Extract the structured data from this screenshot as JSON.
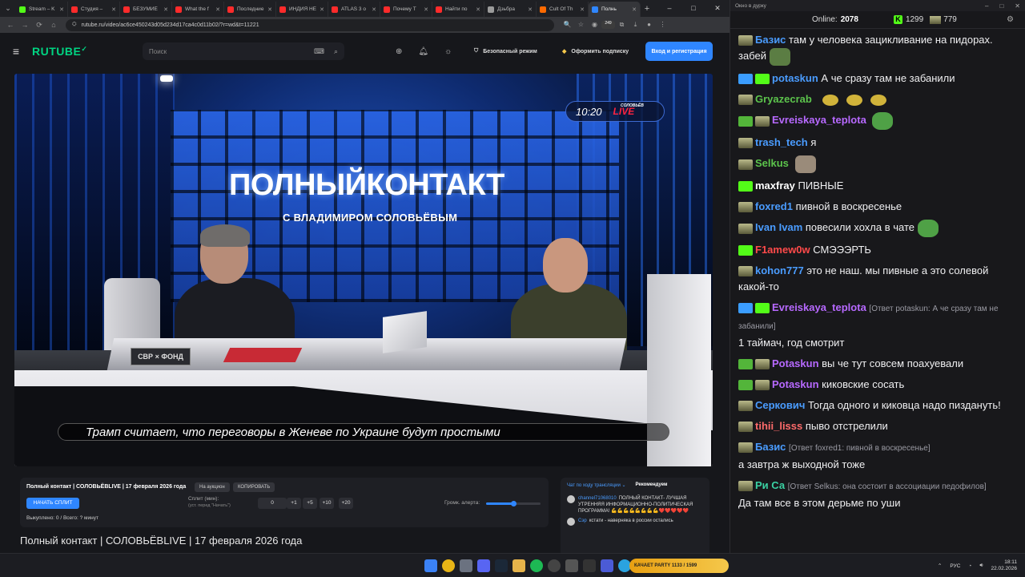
{
  "browser": {
    "tabs": [
      {
        "label": "Stream – K",
        "color": "#53fc18",
        "active": false
      },
      {
        "label": "Студия –",
        "color": "#ff2b2b",
        "active": false
      },
      {
        "label": "БЕЗУМИЕ",
        "color": "#ff2b2b",
        "active": false
      },
      {
        "label": "What the f",
        "color": "#ff2b2b",
        "active": false
      },
      {
        "label": "Последние",
        "color": "#ff2b2b",
        "active": false
      },
      {
        "label": "ИНДИЯ НЕ",
        "color": "#ff2b2b",
        "active": false
      },
      {
        "label": "ATLAS 3 о",
        "color": "#ff2b2b",
        "active": false
      },
      {
        "label": "Почему Т",
        "color": "#ff2b2b",
        "active": false
      },
      {
        "label": "Найти по",
        "color": "#ff2b2b",
        "active": false
      },
      {
        "label": "Дзьбра",
        "color": "#9b9b9b",
        "active": false
      },
      {
        "label": "Cult Of Th",
        "color": "#ff6a00",
        "active": false
      },
      {
        "label": "Полнь",
        "color": "#2f86ff",
        "active": true
      }
    ],
    "url": "rutube.ru/video/ac6ce450243d05d234d17ca4c0d11b02/?r=wd&t=11221",
    "extension_badge": "249"
  },
  "rutube": {
    "logo": "RUTUBE",
    "search_placeholder": "Поиск",
    "safe_mode": "Безопасный режим",
    "subscribe": "Оформить подписку",
    "login": "Вход и регистрация"
  },
  "video": {
    "show_title": "ПОЛНЫЙКОНТАКТ",
    "show_subtitle": "С ВЛАДИМИРОМ СОЛОВЬЁВЫМ",
    "clock": "10:20",
    "live": "LIVE",
    "brand": "СОЛОВЬЁВ",
    "desk_logo": "СВР × ФОНД",
    "caption": "Трамп считает, что переговоры в Женеве по Украине будут простыми"
  },
  "info": {
    "title": "Полный контакт | СОЛОВЬЁВLIVE | 17 февраля 2026 года",
    "chip_auction": "На аукцион",
    "chip_copy": "КОПИРОВАТЬ",
    "start_split": "НАЧАТЬ СПЛИТ",
    "split_label": "Сплит (мин):",
    "split_note": "(уст. перед \"Начать\")",
    "split_value": "0",
    "split_buttons": [
      "+1",
      "+5",
      "+10",
      "+20"
    ],
    "volume_label": "Громк. алерта:",
    "volume_level": 0.5,
    "cut_count": "Выкуплено: 0 / Всего: ? минут",
    "video_title": "Полный контакт | СОЛОВЬЁВLIVE | 17 февраля 2026 года"
  },
  "mini_chat": {
    "tab_chat": "Чат по ходу трансляции ⌄",
    "tab_rec": "Рекомендуем",
    "messages": [
      {
        "user": "channel71068010",
        "text": "ПОЛНЫЙ КОНТАКТ- ЛУЧШАЯ УТРЕННЯЯ ИНФОРМАЦИОННО-ПОЛИТИЧЕСКАЯ ПРОГРАММА! 💪💪💪💪💪💪💪💪❤️❤️❤️❤️❤️"
      },
      {
        "user": "Сэр",
        "text": "кстати - наверняка в россии остались"
      }
    ]
  },
  "chat": {
    "window_title": "Окно в дурку",
    "online_label": "Online:",
    "online_value": "2078",
    "kick_count": "1299",
    "t_count": "779",
    "messages": [
      {
        "badges": [
          "rank"
        ],
        "user": "Базис",
        "color": "#4a9cff",
        "text": "там у человека зацикливание на пидорах. забей",
        "emote": "frog"
      },
      {
        "badges": [
          "sword",
          "k"
        ],
        "user": "potaskun",
        "color": "#4a9cff",
        "text": "А че сразу там не забанили"
      },
      {
        "badges": [
          "rank"
        ],
        "user": "Gryazecrab",
        "color": "#5cc44c",
        "text": "",
        "emote": "potato3"
      },
      {
        "badges": [
          "check",
          "rank"
        ],
        "user": "Evreiskaya_teplota",
        "color": "#b769ff",
        "text": "",
        "emote": "pepe"
      },
      {
        "badges": [
          "rank"
        ],
        "user": "trash_tech",
        "color": "#4a9cff",
        "text": "я"
      },
      {
        "badges": [
          "rank"
        ],
        "user": "Selkus",
        "color": "#5cc44c",
        "text": "",
        "emote": "cat"
      },
      {
        "badges": [
          "k"
        ],
        "user": "maxfray",
        "color": "#ffffff",
        "text": "ПИВНЫЕ"
      },
      {
        "badges": [
          "rank"
        ],
        "user": "foxred1",
        "color": "#4a9cff",
        "text": "пивной в воскресенье"
      },
      {
        "badges": [
          "rank"
        ],
        "user": "Ivan Ivam",
        "color": "#4a9cff",
        "text": "повесили хохла в чате",
        "emote": "pepe"
      },
      {
        "badges": [
          "k"
        ],
        "user": "F1amew0w",
        "color": "#ff4a4a",
        "text": "СМЭЭЭРТЬ"
      },
      {
        "badges": [
          "rank"
        ],
        "user": "kohon777",
        "color": "#4a9cff",
        "text": "это не наш. мы пивные а это солевой какой-то"
      },
      {
        "badges": [
          "sword",
          "k"
        ],
        "user": "Evreiskaya_teplota",
        "color": "#b769ff",
        "reply": "[Ответ potaskun: А че сразу там не забанили]",
        "text": "1 таймач, год смотрит"
      },
      {
        "badges": [
          "check",
          "rank"
        ],
        "user": "Potaskun",
        "color": "#b769ff",
        "text": "вы че тут совсем поахуевали"
      },
      {
        "badges": [
          "check",
          "rank"
        ],
        "user": "Potaskun",
        "color": "#b769ff",
        "text": "киковские сосать"
      },
      {
        "badges": [
          "rank"
        ],
        "user": "Серкович",
        "color": "#4a9cff",
        "text": "Тогда одного и киковца надо пиздануть!"
      },
      {
        "badges": [
          "rank"
        ],
        "user": "tihii_lisss",
        "color": "#ff6b6b",
        "text": "пыво отстрелили"
      },
      {
        "badges": [
          "rank"
        ],
        "user": "Базис",
        "color": "#4a9cff",
        "reply": "[Ответ foxred1: пивной в воскресенье]",
        "text": "а завтра ж выходной тоже"
      },
      {
        "badges": [
          "rank"
        ],
        "user": "Ри Са",
        "color": "#3ad1a3",
        "reply": "[Ответ Selkus: она состоит в ассоциации педофилов]",
        "text": "Да там все в этом дерьме по уши"
      }
    ]
  },
  "taskbar": {
    "now_playing": "КАЧАЕТ PARTY 1133 / 1599",
    "lang": "РУС",
    "time": "18:11",
    "date": "22.02.2026"
  }
}
